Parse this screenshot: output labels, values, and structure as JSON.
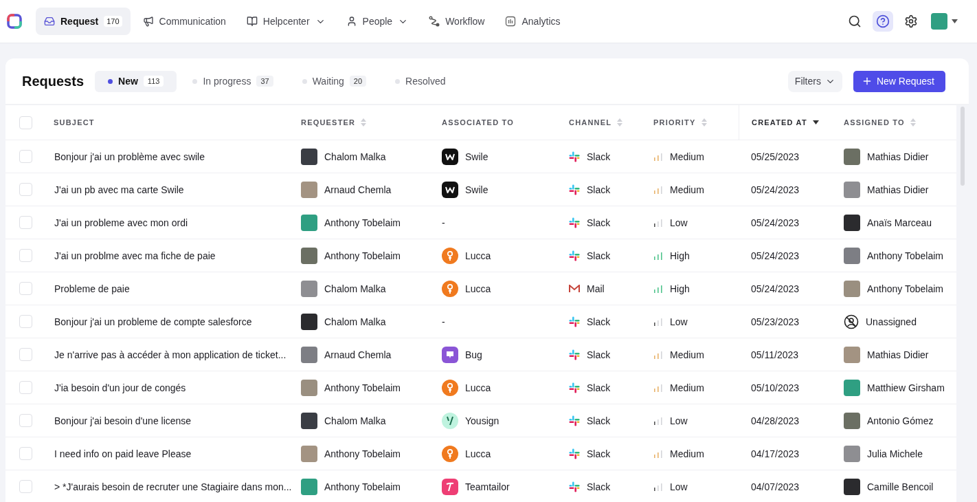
{
  "nav": {
    "items": [
      {
        "label": "Request",
        "kind": "inbox",
        "badge": "170",
        "selected": true,
        "dropdown": false
      },
      {
        "label": "Communication",
        "kind": "megaphone",
        "selected": false,
        "dropdown": false
      },
      {
        "label": "Helpcenter",
        "kind": "book",
        "selected": false,
        "dropdown": true
      },
      {
        "label": "People",
        "kind": "user",
        "selected": false,
        "dropdown": true
      },
      {
        "label": "Workflow",
        "kind": "workflow",
        "selected": false,
        "dropdown": false
      },
      {
        "label": "Analytics",
        "kind": "chart",
        "selected": false,
        "dropdown": false
      }
    ],
    "actions": [
      {
        "kind": "search",
        "selected": false
      },
      {
        "kind": "help",
        "selected": true
      },
      {
        "kind": "settings",
        "selected": false
      }
    ]
  },
  "page": {
    "title": "Requests",
    "tabs": [
      {
        "label": "New",
        "count": "113",
        "selected": true
      },
      {
        "label": "In progress",
        "count": "37",
        "selected": false
      },
      {
        "label": "Waiting",
        "count": "20",
        "selected": false
      },
      {
        "label": "Resolved",
        "selected": false
      }
    ],
    "filters": "Filters",
    "new_button": "New Request"
  },
  "table": {
    "select_all_checked": false,
    "columns": [
      {
        "label": "SUBJECT"
      },
      {
        "label": "REQUESTER",
        "sortable": true,
        "sorted": false
      },
      {
        "label": "ASSOCIATED TO"
      },
      {
        "label": "CHANNEL",
        "sortable": true,
        "sorted": false
      },
      {
        "label": "PRIORITY",
        "sortable": true,
        "sorted": false
      },
      {
        "label": "CREATED AT",
        "sortable": true,
        "sorted": true
      },
      {
        "label": "ASSIGNED TO",
        "sortable": true,
        "sorted": false
      }
    ],
    "rows": [
      {
        "checked": false,
        "subject": "Bonjour j'ai un problème avec swile",
        "requester": "Chalom Malka",
        "associated": {
          "kind": "swile",
          "label": "Swile"
        },
        "channel": {
          "kind": "slack",
          "label": "Slack"
        },
        "priority": {
          "kind": "medium",
          "label": "Medium"
        },
        "created": "05/25/2023",
        "assigned": {
          "kind": "person",
          "label": "Mathias Didier"
        }
      },
      {
        "checked": false,
        "subject": "J'ai un pb avec ma carte Swile",
        "requester": "Arnaud Chemla",
        "associated": {
          "kind": "swile",
          "label": "Swile"
        },
        "channel": {
          "kind": "slack",
          "label": "Slack"
        },
        "priority": {
          "kind": "medium",
          "label": "Medium"
        },
        "created": "05/24/2023",
        "assigned": {
          "kind": "person",
          "label": "Mathias Didier"
        }
      },
      {
        "checked": false,
        "subject": "J'ai un probleme avec mon ordi",
        "requester": "Anthony Tobelaim",
        "associated": {
          "kind": "none",
          "label": "-"
        },
        "channel": {
          "kind": "slack",
          "label": "Slack"
        },
        "priority": {
          "kind": "low",
          "label": "Low"
        },
        "created": "05/24/2023",
        "assigned": {
          "kind": "person",
          "label": "Anaïs Marceau"
        }
      },
      {
        "checked": false,
        "subject": "J'ai un problme avec ma fiche de paie",
        "requester": "Anthony Tobelaim",
        "associated": {
          "kind": "lucca",
          "label": "Lucca"
        },
        "channel": {
          "kind": "slack",
          "label": "Slack"
        },
        "priority": {
          "kind": "high",
          "label": "High"
        },
        "created": "05/24/2023",
        "assigned": {
          "kind": "person",
          "label": "Anthony Tobelaim"
        }
      },
      {
        "checked": false,
        "subject": "Probleme de paie",
        "requester": "Chalom Malka",
        "associated": {
          "kind": "lucca",
          "label": "Lucca"
        },
        "channel": {
          "kind": "mail",
          "label": "Mail"
        },
        "priority": {
          "kind": "high",
          "label": "High"
        },
        "created": "05/24/2023",
        "assigned": {
          "kind": "person",
          "label": "Anthony Tobelaim"
        }
      },
      {
        "checked": false,
        "subject": "Bonjour j'ai un probleme de compte salesforce",
        "requester": "Chalom Malka",
        "associated": {
          "kind": "none",
          "label": "-"
        },
        "channel": {
          "kind": "slack",
          "label": "Slack"
        },
        "priority": {
          "kind": "low",
          "label": "Low"
        },
        "created": "05/23/2023",
        "assigned": {
          "kind": "unassigned",
          "label": "Unassigned"
        }
      },
      {
        "checked": false,
        "subject": "Je n'arrive pas à accéder à mon application de ticket...",
        "requester": "Arnaud Chemla",
        "associated": {
          "kind": "bug",
          "label": "Bug"
        },
        "channel": {
          "kind": "slack",
          "label": "Slack"
        },
        "priority": {
          "kind": "medium",
          "label": "Medium"
        },
        "created": "05/11/2023",
        "assigned": {
          "kind": "person",
          "label": "Mathias Didier"
        }
      },
      {
        "checked": false,
        "subject": "J'ia besoin d'un jour de congés",
        "requester": "Anthony Tobelaim",
        "associated": {
          "kind": "lucca",
          "label": "Lucca"
        },
        "channel": {
          "kind": "slack",
          "label": "Slack"
        },
        "priority": {
          "kind": "medium",
          "label": "Medium"
        },
        "created": "05/10/2023",
        "assigned": {
          "kind": "person",
          "label": "Matthiew Girsham"
        }
      },
      {
        "checked": false,
        "subject": "Bonjour j'ai besoin d'une license",
        "requester": "Chalom Malka",
        "associated": {
          "kind": "yousign",
          "label": "Yousign"
        },
        "channel": {
          "kind": "slack",
          "label": "Slack"
        },
        "priority": {
          "kind": "low",
          "label": "Low"
        },
        "created": "04/28/2023",
        "assigned": {
          "kind": "person",
          "label": "Antonio Gómez"
        }
      },
      {
        "checked": false,
        "subject": "I need info on paid leave Please",
        "requester": "Anthony Tobelaim",
        "associated": {
          "kind": "lucca",
          "label": "Lucca"
        },
        "channel": {
          "kind": "slack",
          "label": "Slack"
        },
        "priority": {
          "kind": "medium",
          "label": "Medium"
        },
        "created": "04/17/2023",
        "assigned": {
          "kind": "person",
          "label": "Julia Michele"
        }
      },
      {
        "checked": false,
        "subject": "> *J'aurais besoin de recruter une Stagiaire dans mon...",
        "requester": "Anthony Tobelaim",
        "associated": {
          "kind": "teamtailor",
          "label": "Teamtailor"
        },
        "channel": {
          "kind": "slack",
          "label": "Slack"
        },
        "priority": {
          "kind": "low",
          "label": "Low"
        },
        "created": "04/07/2023",
        "assigned": {
          "kind": "person",
          "label": "Camille Bencoil"
        }
      }
    ]
  }
}
